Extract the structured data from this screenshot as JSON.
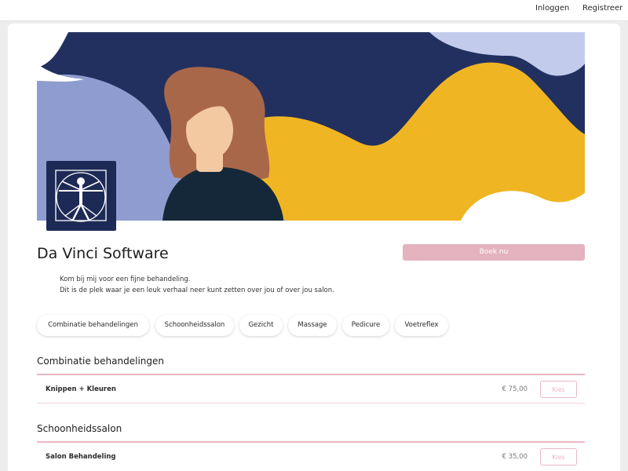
{
  "topnav": {
    "login_label": "Inloggen",
    "register_label": "Registreer"
  },
  "colors": {
    "navy": "#22305f",
    "yellow": "#f0b523",
    "periwinkle": "#8f9ccf",
    "light_periwinkle": "#c3cbed",
    "accent_pink": "#e4b3bf",
    "hair": "#a9674a",
    "skin": "#f3c9a2"
  },
  "hero": {
    "logo_icon": "vitruvian-man-icon"
  },
  "business": {
    "name": "Da Vinci Software",
    "book_label": "Boek nu",
    "intro_lines": [
      "Kom bij mij voor een fijne behandeling.",
      "Dit is de plek waar je een leuk verhaal neer kunt zetten over jou of over jou salon."
    ]
  },
  "categories": [
    "Combinatie behandelingen",
    "Schoonheidssalon",
    "Gezicht",
    "Massage",
    "Pedicure",
    "Voetreflex"
  ],
  "sections": [
    {
      "title": "Combinatie behandelingen",
      "services": [
        {
          "name": "Knippen + Kleuren",
          "price": "€ 75,00",
          "button": "Kies"
        }
      ]
    },
    {
      "title": "Schoonheidssalon",
      "services": [
        {
          "name": "Salon Behandeling",
          "price": "€ 35,00",
          "button": "Kies"
        }
      ]
    }
  ]
}
